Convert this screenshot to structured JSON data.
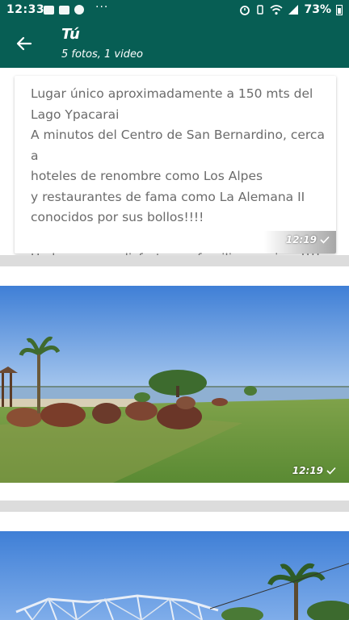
{
  "status_bar": {
    "time": "12:33",
    "more": "···",
    "battery_percent": "73%",
    "icons": [
      "gallery-icon",
      "messaging-icon",
      "facebook-icon",
      "alarm-icon",
      "vibrate-icon",
      "wifi-icon",
      "signal-icon"
    ]
  },
  "header": {
    "title": "Tú",
    "subtitle": "5 fotos, 1 video"
  },
  "messages": [
    {
      "type": "text",
      "text": "Lugar único aproximadamente a 150 mts del\nLago Ypacarai\nA minutos del Centro de San Bernardino, cerca a\nhoteles de renombre como Los Alpes\ny restaurantes de fama como La Alemana II\nconocidos por sus bollos!!!!\n\nUn lugar para disfrutar en familia y amigos!!!!",
      "time": "12:19",
      "status": "sent"
    },
    {
      "type": "photo",
      "description_icon": "lake-shore-photo",
      "time": "12:19",
      "status": "sent"
    },
    {
      "type": "photo",
      "description_icon": "palm-tree-photo",
      "time": "",
      "status": "sent"
    }
  ],
  "colors": {
    "header": "#075e54",
    "background": "#ece5dd",
    "text_gray": "#6b6b6b",
    "sky": "#4c86d8",
    "grass": "#6e9a3e"
  }
}
